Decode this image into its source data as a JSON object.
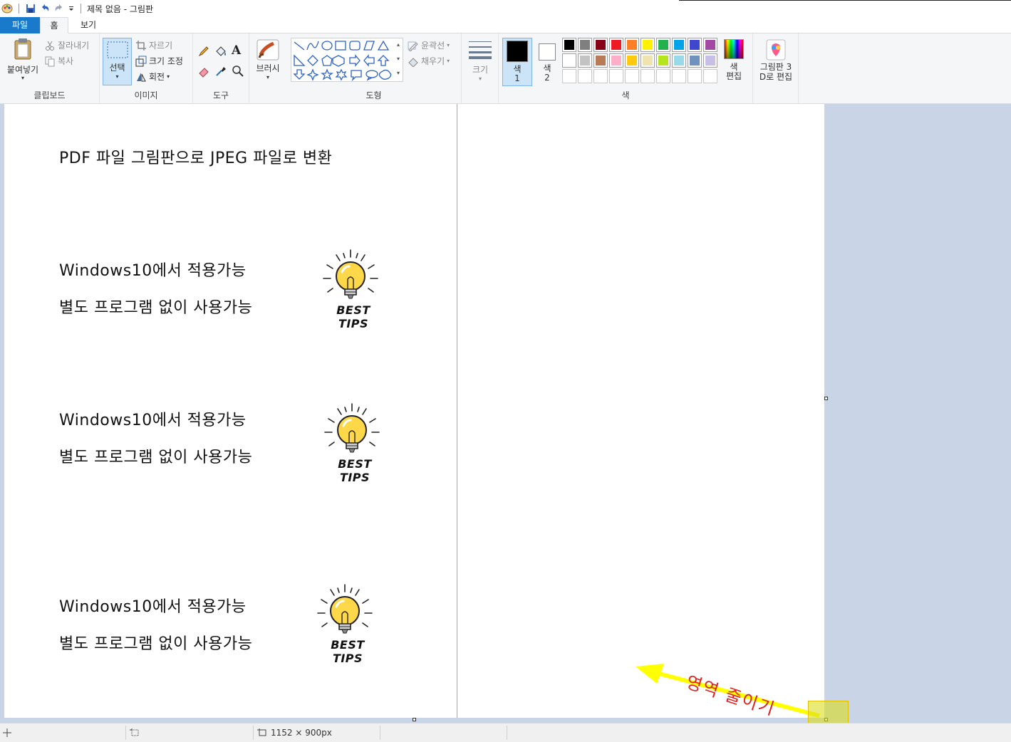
{
  "window": {
    "title": "제목 없음 - 그림판"
  },
  "tabs": {
    "file": "파일",
    "home": "홈",
    "view": "보기"
  },
  "clipboard": {
    "paste": "붙여넣기",
    "cut": "잘라내기",
    "copy": "복사",
    "label": "클립보드"
  },
  "image": {
    "select": "선택",
    "crop": "자르기",
    "resize": "크기 조정",
    "rotate": "회전",
    "label": "이미지"
  },
  "tools": {
    "label": "도구"
  },
  "brushes": {
    "label": "브러시"
  },
  "shapes": {
    "outline": "윤곽선",
    "fill": "채우기",
    "label": "도형"
  },
  "size": {
    "label": "크기"
  },
  "colors": {
    "color1": "색\n1",
    "color1_a": "색",
    "color1_b": "1",
    "color2_a": "색",
    "color2_b": "2",
    "edit_a": "색",
    "edit_b": "편집",
    "label": "색",
    "palette_row1": [
      "#000000",
      "#7f7f7f",
      "#880015",
      "#ed1c24",
      "#ff7f27",
      "#fff200",
      "#22b14c",
      "#00a2e8",
      "#3f48cc",
      "#a349a4"
    ],
    "palette_row2": [
      "#ffffff",
      "#c3c3c3",
      "#b97a57",
      "#ffaec9",
      "#ffc90e",
      "#efe4b0",
      "#b5e61d",
      "#99d9ea",
      "#7092be",
      "#c8bfe7"
    ]
  },
  "paint3d": {
    "line1": "그림판 3",
    "line2": "D로 편집"
  },
  "document": {
    "heading": "PDF 파일 그림판으로 JPEG 파일로 변환",
    "blocks": [
      {
        "line1": "Windows10에서 적용가능",
        "line2": "별도 프로그램 없이 사용가능",
        "badge": "BEST TIPS"
      },
      {
        "line1": "Windows10에서 적용가능",
        "line2": "별도 프로그램 없이 사용가능",
        "badge": "BEST TIPS"
      },
      {
        "line1": "Windows10에서 적용가능",
        "line2": "별도 프로그램 없이 사용가능",
        "badge": "BEST TIPS"
      }
    ]
  },
  "annotation": {
    "label": "영역 줄이기",
    "arrow_color": "#ffff00",
    "text_color": "#e02020"
  },
  "status": {
    "canvas_size": "1152 × 900px"
  }
}
